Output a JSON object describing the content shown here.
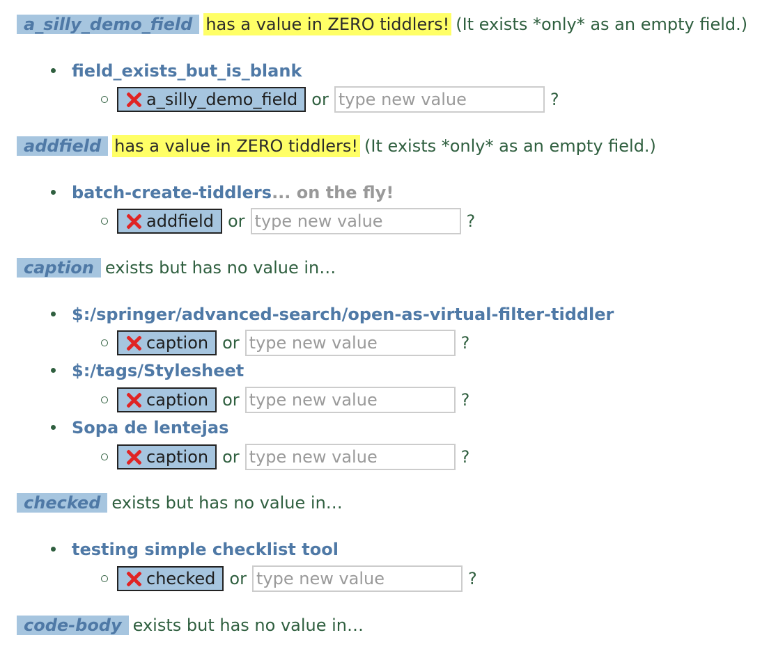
{
  "sections": [
    {
      "field": "a_silly_demo_field",
      "zero_text": "has a value in ZERO tiddlers!",
      "rest_text": "(It exists *only* as an empty field.)",
      "items": [
        {
          "tiddler": "field_exists_but_is_blank",
          "suffix": "",
          "button": "a_silly_demo_field",
          "or": "or",
          "placeholder": "type new value",
          "q": "?"
        }
      ]
    },
    {
      "field": "addfield",
      "zero_text": "has a value in ZERO tiddlers!",
      "rest_text": "(It exists *only* as an empty field.)",
      "items": [
        {
          "tiddler": "batch-create-tiddlers",
          "suffix": "... on the fly!",
          "button": "addfield",
          "or": "or",
          "placeholder": "type new value",
          "q": "?"
        }
      ]
    },
    {
      "field": "caption",
      "zero_text": "",
      "rest_text": "exists but has no value in…",
      "items": [
        {
          "tiddler": "$:/springer/advanced-search/open-as-virtual-filter-tiddler",
          "suffix": "",
          "button": "caption",
          "or": "or",
          "placeholder": "type new value",
          "q": "?"
        },
        {
          "tiddler": "$:/tags/Stylesheet",
          "suffix": "",
          "button": "caption",
          "or": "or",
          "placeholder": "type new value",
          "q": "?"
        },
        {
          "tiddler": "Sopa de lentejas",
          "suffix": "",
          "button": "caption",
          "or": "or",
          "placeholder": "type new value",
          "q": "?"
        }
      ]
    },
    {
      "field": "checked",
      "zero_text": "",
      "rest_text": "exists but has no value in…",
      "items": [
        {
          "tiddler": "testing simple checklist tool",
          "suffix": "",
          "button": "checked",
          "or": "or",
          "placeholder": "type new value",
          "q": "?"
        }
      ]
    },
    {
      "field": "code-body",
      "zero_text": "",
      "rest_text": "exists but has no value in…",
      "items": []
    }
  ],
  "colors": {
    "field_tag_bg": "#a6c5df",
    "field_tag_text": "#4f79a6",
    "highlight": "#ffff66",
    "body_text": "#2f5f3f",
    "delete_icon": "#e02424"
  }
}
